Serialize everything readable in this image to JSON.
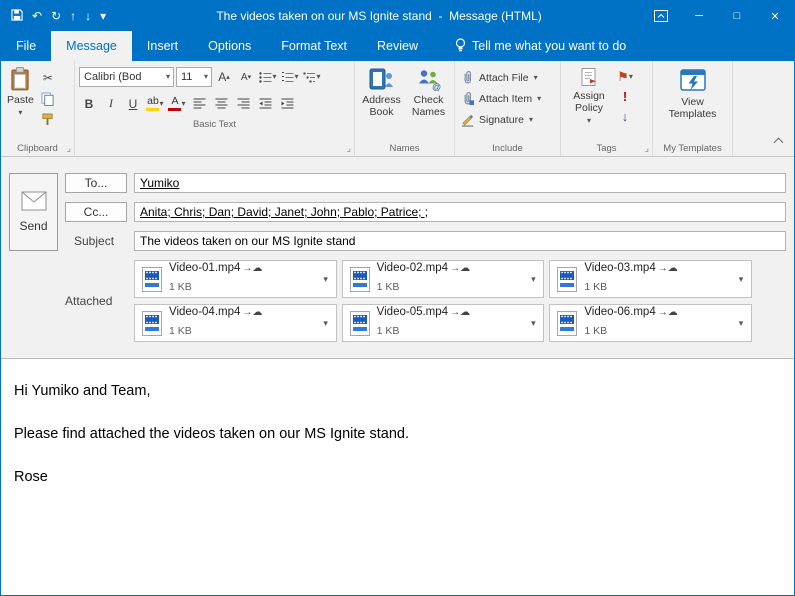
{
  "titlebar": {
    "title": "The videos taken on our MS Ignite stand  -  Message (HTML)"
  },
  "tabs": [
    "File",
    "Message",
    "Insert",
    "Options",
    "Format Text",
    "Review"
  ],
  "tell_me_label": "Tell me what you want to do",
  "ribbon": {
    "clipboard": {
      "paste": "Paste",
      "label": "Clipboard"
    },
    "basic_text": {
      "font_name": "Calibri (Bod",
      "font_size": "11",
      "bold": "B",
      "italic": "I",
      "underline": "U",
      "highlight": "ab",
      "font_color": "A",
      "label": "Basic Text"
    },
    "names": {
      "address_book": "Address Book",
      "check_names": "Check Names",
      "label": "Names"
    },
    "include": {
      "attach_file": "Attach File",
      "attach_item": "Attach Item",
      "signature": "Signature",
      "label": "Include"
    },
    "tags": {
      "assign_policy": "Assign Policy",
      "importance_high": "!",
      "label": "Tags"
    },
    "my_templates": {
      "view_templates": "View Templates",
      "label": "My Templates"
    }
  },
  "compose": {
    "send": "Send",
    "to_label": "To...",
    "to_value": "Yumiko",
    "cc_label": "Cc...",
    "cc_value": "Anita; Chris; Dan; David; Janet; John; Pablo; Patrice; ;",
    "subject_label": "Subject",
    "subject_value": "The videos taken on our MS Ignite stand",
    "attached_label": "Attached",
    "attachments": [
      {
        "name": "Video-01.mp4",
        "size": "1 KB"
      },
      {
        "name": "Video-02.mp4",
        "size": "1 KB"
      },
      {
        "name": "Video-03.mp4",
        "size": "1 KB"
      },
      {
        "name": "Video-04.mp4",
        "size": "1 KB"
      },
      {
        "name": "Video-05.mp4",
        "size": "1 KB"
      },
      {
        "name": "Video-06.mp4",
        "size": "1 KB"
      }
    ]
  },
  "body": {
    "greeting": "Hi Yumiko and Team,",
    "message": "Please find attached the videos taken on our MS Ignite stand.",
    "signature": "Rose"
  },
  "glyphs": {
    "undo": "↶",
    "redo": "↻",
    "up": "↑",
    "down": "↓",
    "caret": "▾",
    "tri_up": "▴",
    "minimize": "─",
    "maximize": "□",
    "close": "✕",
    "scissors": "✂",
    "grow_font": "A",
    "shrink_font": "A",
    "flag": "⚑",
    "importance_low": "↓",
    "upload_cloud": "→☁",
    "launcher": "⌟"
  }
}
